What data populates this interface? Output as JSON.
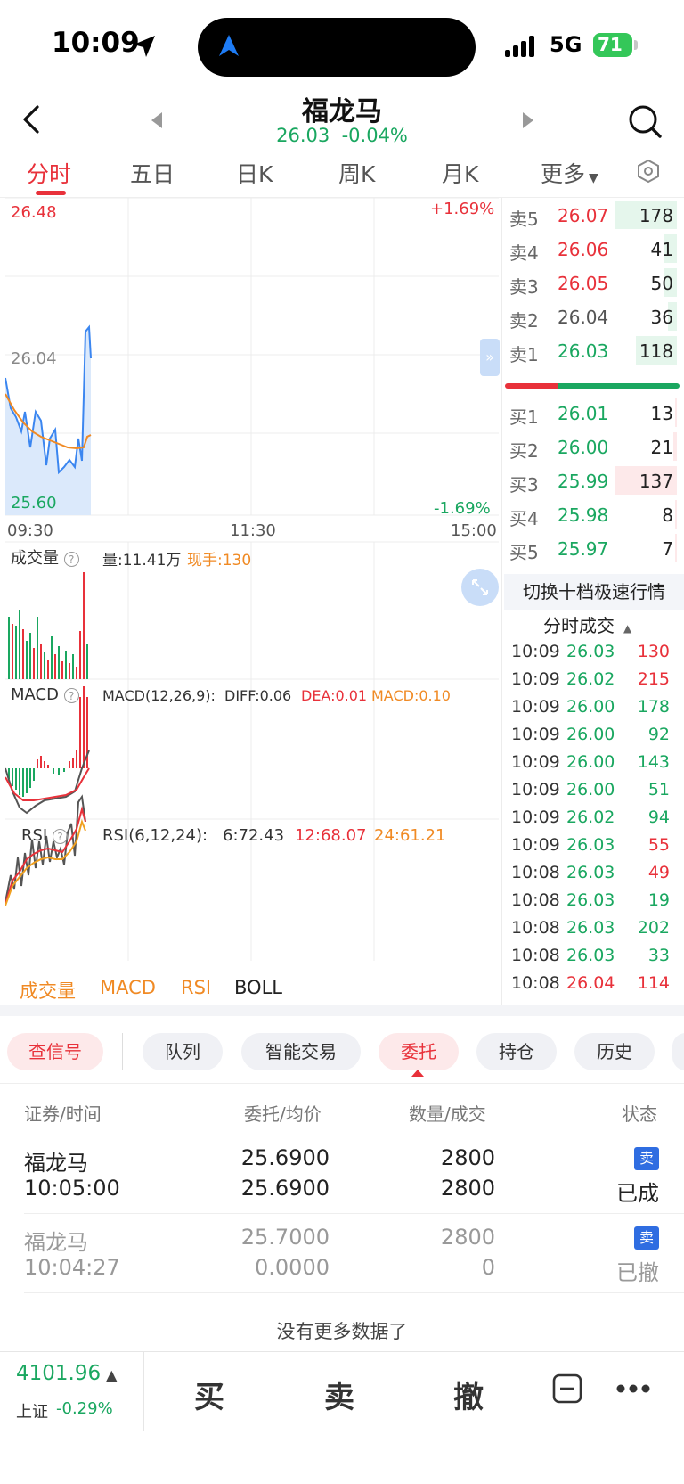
{
  "status": {
    "time": "10:09",
    "network": "5G",
    "battery": "71"
  },
  "header": {
    "title": "福龙马",
    "price": "26.03",
    "change": "-0.04%"
  },
  "tabs": [
    "分时",
    "五日",
    "日K",
    "周K",
    "月K",
    "更多"
  ],
  "chart": {
    "price_high": "26.48",
    "price_mid": "26.04",
    "price_low": "25.60",
    "pct_high": "+1.69%",
    "pct_low": "-1.69%",
    "time_start": "09:30",
    "time_mid": "11:30",
    "time_end": "15:00",
    "volume_label": "成交量",
    "volume_value": "量:11.41万",
    "volume_now": "现手:130",
    "macd_label": "MACD",
    "macd_params": "MACD(12,26,9):",
    "diff": "DIFF:0.06",
    "dea": "DEA:0.01",
    "macd": "MACD:0.10",
    "rsi_label": "RSI",
    "rsi_params": "RSI(6,12,24):",
    "rsi6": "6:72.43",
    "rsi12": "12:68.07",
    "rsi24": "24:61.21",
    "indicators": [
      "成交量",
      "MACD",
      "RSI",
      "BOLL"
    ]
  },
  "orderbook": {
    "asks": [
      {
        "side": "卖5",
        "price": "26.07",
        "vol": "178",
        "color": "#e8313a"
      },
      {
        "side": "卖4",
        "price": "26.06",
        "vol": "41",
        "color": "#e8313a"
      },
      {
        "side": "卖3",
        "price": "26.05",
        "vol": "50",
        "color": "#e8313a"
      },
      {
        "side": "卖2",
        "price": "26.04",
        "vol": "36",
        "color": "#555555"
      },
      {
        "side": "卖1",
        "price": "26.03",
        "vol": "118",
        "color": "#1aa760"
      }
    ],
    "bids": [
      {
        "side": "买1",
        "price": "26.01",
        "vol": "13",
        "color": "#1aa760"
      },
      {
        "side": "买2",
        "price": "26.00",
        "vol": "21",
        "color": "#1aa760"
      },
      {
        "side": "买3",
        "price": "25.99",
        "vol": "137",
        "color": "#1aa760"
      },
      {
        "side": "买4",
        "price": "25.98",
        "vol": "8",
        "color": "#1aa760"
      },
      {
        "side": "买5",
        "price": "25.97",
        "vol": "7",
        "color": "#1aa760"
      }
    ],
    "switch_label": "切换十档极速行情",
    "ticks_title": "分时成交",
    "ticks": [
      {
        "t": "10:09",
        "p": "26.03",
        "v": "130",
        "vc": "#e8313a"
      },
      {
        "t": "10:09",
        "p": "26.02",
        "v": "215",
        "vc": "#e8313a"
      },
      {
        "t": "10:09",
        "p": "26.00",
        "v": "178",
        "vc": "#1aa760"
      },
      {
        "t": "10:09",
        "p": "26.00",
        "v": "92",
        "vc": "#1aa760"
      },
      {
        "t": "10:09",
        "p": "26.00",
        "v": "143",
        "vc": "#1aa760"
      },
      {
        "t": "10:09",
        "p": "26.00",
        "v": "51",
        "vc": "#1aa760"
      },
      {
        "t": "10:09",
        "p": "26.02",
        "v": "94",
        "vc": "#1aa760"
      },
      {
        "t": "10:09",
        "p": "26.03",
        "v": "55",
        "vc": "#e8313a"
      },
      {
        "t": "10:08",
        "p": "26.03",
        "v": "49",
        "vc": "#e8313a"
      },
      {
        "t": "10:08",
        "p": "26.03",
        "v": "19",
        "vc": "#1aa760"
      },
      {
        "t": "10:08",
        "p": "26.03",
        "v": "202",
        "vc": "#1aa760"
      },
      {
        "t": "10:08",
        "p": "26.03",
        "v": "33",
        "vc": "#1aa760"
      },
      {
        "t": "10:08",
        "p": "26.04",
        "v": "114",
        "vc": "#e8313a"
      }
    ]
  },
  "lower_tabs": [
    "查信号",
    "队列",
    "智能交易",
    "委托",
    "持仓",
    "历史"
  ],
  "orders": {
    "headers": [
      "证券/时间",
      "委托/均价",
      "数量/成交",
      "状态"
    ],
    "rows": [
      {
        "name": "福龙马",
        "time": "10:05:00",
        "price": "25.6900",
        "avg": "25.6900",
        "qty": "2800",
        "filled": "2800",
        "badge": "卖",
        "status": "已成"
      },
      {
        "name": "福龙马",
        "time": "10:04:27",
        "price": "25.7000",
        "avg": "0.0000",
        "qty": "2800",
        "filled": "0",
        "badge": "卖",
        "status": "已撤"
      }
    ],
    "no_more": "没有更多数据了"
  },
  "bottom": {
    "index_value": "4101.96",
    "index_name": "上证",
    "index_change": "-0.29%",
    "buy": "买",
    "sell": "卖",
    "cancel": "撤"
  }
}
